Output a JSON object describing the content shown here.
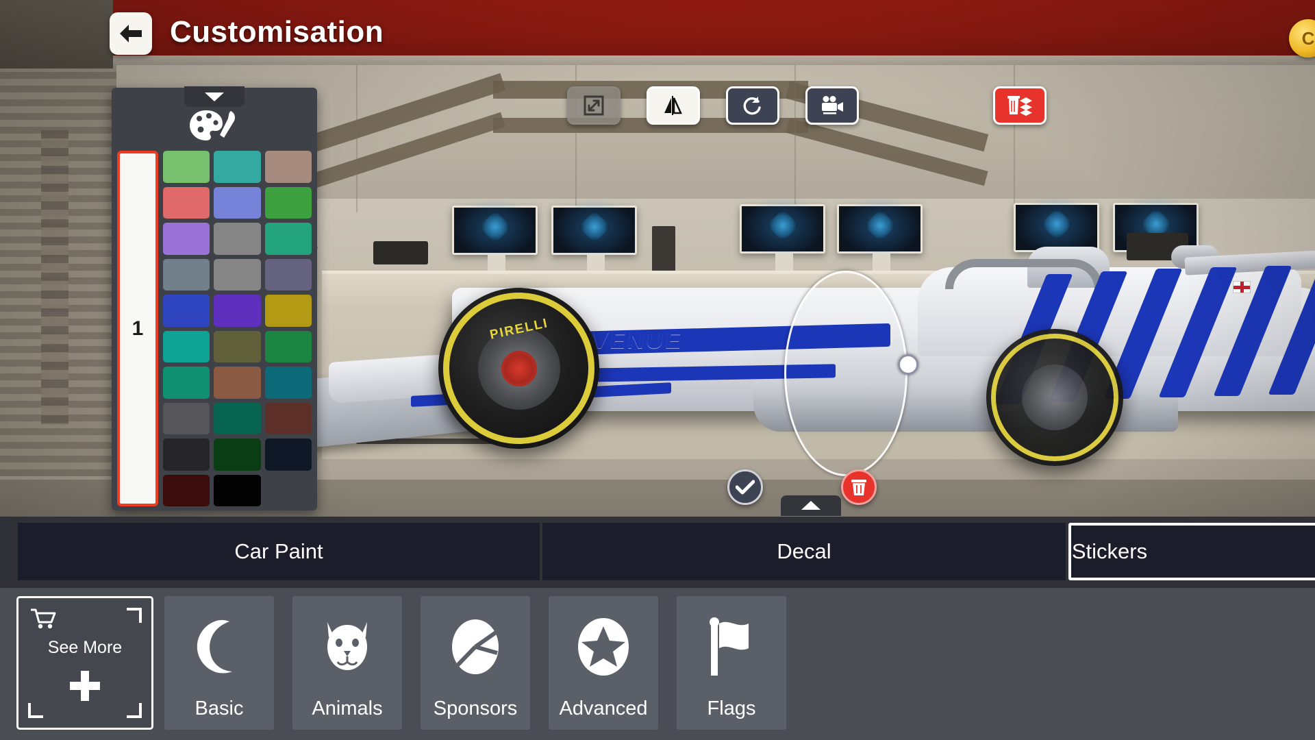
{
  "header": {
    "title": "Customisation",
    "back_icon": "back-arrow-icon",
    "currency_glyph": "C"
  },
  "toolbar": {
    "buttons": [
      {
        "name": "scale-tool",
        "icon": "resize-arrows-icon",
        "state": "disabled"
      },
      {
        "name": "mirror-tool",
        "icon": "mirror-flip-icon",
        "state": "active"
      },
      {
        "name": "reset-tool",
        "icon": "rotate-counterclockwise-icon",
        "state": "normal"
      },
      {
        "name": "camera-tool",
        "icon": "video-camera-icon",
        "state": "normal"
      },
      {
        "name": "delete-all-layers-tool",
        "icon": "trash-layers-icon",
        "state": "danger"
      }
    ]
  },
  "palette": {
    "collapse_icon": "chevron-down-icon",
    "header_icon": "paint-palette-icon",
    "selected_slot_label": "1",
    "selected_color": "#f8f8f6",
    "selected_border": "#ef3b21",
    "swatches": [
      "#76c06e",
      "#34a9a2",
      "#a68a7e",
      "#e0696a",
      "#7683d8",
      "#3da03f",
      "#9a72d8",
      "#858585",
      "#23a47c",
      "#72808c",
      "#858585",
      "#64627e",
      "#2f45c0",
      "#5f2fbe",
      "#b29a14",
      "#0fa395",
      "#60603a",
      "#1a8641",
      "#0f9070",
      "#8b5a42",
      "#0c6a79",
      "#56565a",
      "#07644f",
      "#5c2f28",
      "#262628",
      "#0b3d15",
      "#101828",
      "#3a0d0c",
      "#030303",
      null
    ]
  },
  "decal_controls": {
    "confirm_icon": "checkmark-icon",
    "delete_icon": "trash-icon",
    "expand_icon": "chevron-up-icon",
    "gizmo": "selection-ring-handle"
  },
  "tabs": [
    {
      "label": "Car Paint",
      "selected": false
    },
    {
      "label": "Decal",
      "selected": false
    },
    {
      "label": "Stickers",
      "selected": true
    }
  ],
  "see_more": {
    "label": "See More",
    "cart_icon": "shopping-cart-icon",
    "plus_icon": "plus-icon"
  },
  "categories": [
    {
      "label": "Basic",
      "icon": "crescent-moon-icon"
    },
    {
      "label": "Animals",
      "icon": "tiger-face-icon"
    },
    {
      "label": "Sponsors",
      "icon": "pie-chart-icon"
    },
    {
      "label": "Advanced",
      "icon": "star-circle-icon"
    },
    {
      "label": "Flags",
      "icon": "flag-icon"
    }
  ],
  "car": {
    "livery_text": "AVENUE",
    "tyre_brand": "PIRELLI",
    "livery_primary": "#1c36b8",
    "livery_secondary": "#f4f5f7"
  }
}
